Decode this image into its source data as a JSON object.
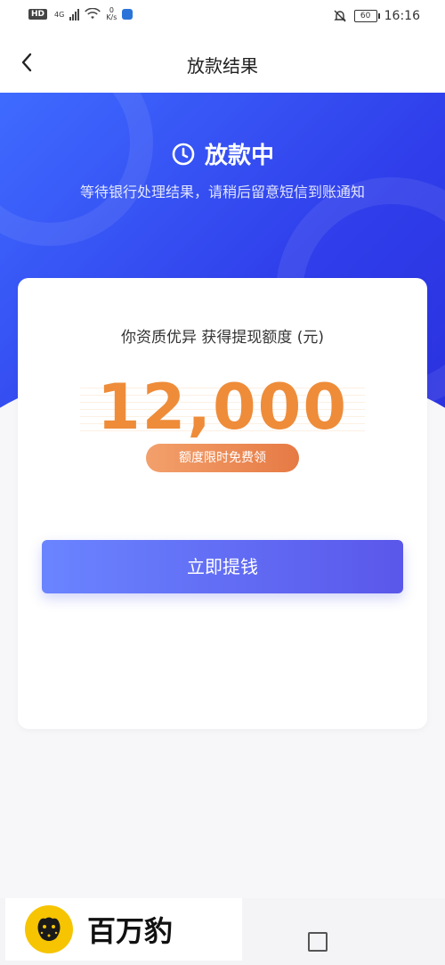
{
  "status_bar": {
    "hd": "HD",
    "network": "4G",
    "speed_value": "0",
    "speed_unit": "K/s",
    "battery": "60",
    "time": "16:16"
  },
  "header": {
    "title": "放款结果"
  },
  "hero": {
    "status_title": "放款中",
    "status_subtitle": "等待银行处理结果，请稍后留意短信到账通知"
  },
  "card": {
    "caption": "你资质优异 获得提现额度 (元)",
    "amount": "12,000",
    "badge": "额度限时免费领",
    "button": "立即提钱"
  },
  "brand": {
    "name": "百万豹"
  },
  "colors": {
    "hero_blue": "#2f3dea",
    "amount_orange": "#ee8c3a",
    "button_blue": "#5a66f0"
  }
}
